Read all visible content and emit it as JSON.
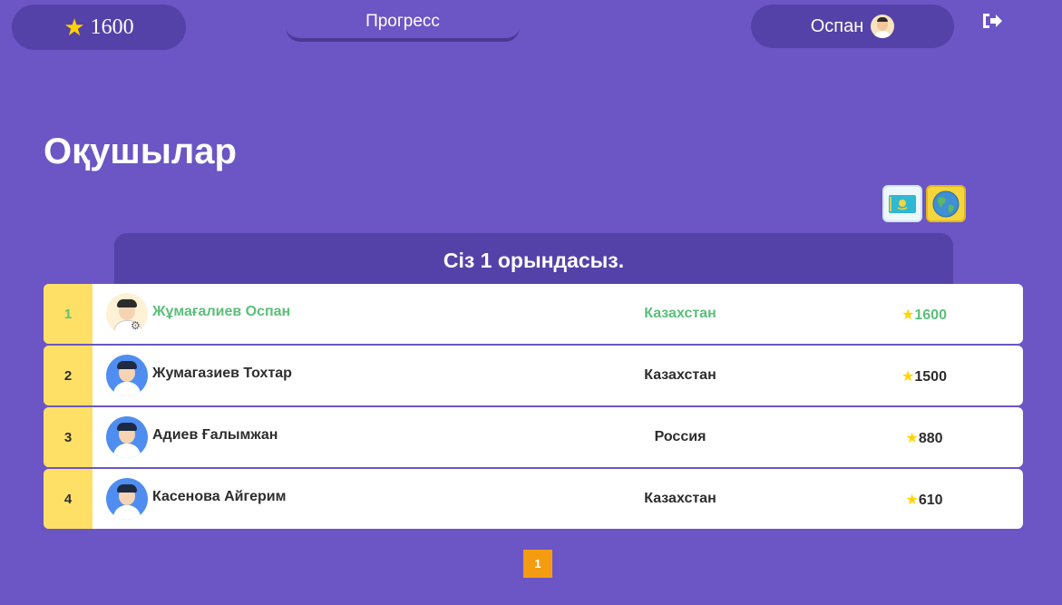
{
  "header": {
    "score": "1600",
    "progress_label": "Прогресс",
    "user_name": "Оспан"
  },
  "page": {
    "title": "Оқушылар",
    "rank_message": "Сіз 1 орындасыз."
  },
  "filters": [
    {
      "name": "kazakhstan-flag-icon"
    },
    {
      "name": "globe-icon"
    }
  ],
  "leaderboard": [
    {
      "rank": "1",
      "name": "Жұмағалиев Оспан",
      "country": "Казахстан",
      "points": "1600",
      "current_user": true
    },
    {
      "rank": "2",
      "name": "Жумагазиев Тохтар",
      "country": "Казахстан",
      "points": "1500"
    },
    {
      "rank": "3",
      "name": "Адиев Ғалымжан",
      "country": "Россия",
      "points": "880"
    },
    {
      "rank": "4",
      "name": "Касенова Айгерим",
      "country": "Казахстан",
      "points": "610"
    }
  ],
  "pagination": {
    "current_page": "1"
  },
  "colors": {
    "background": "#6c55c4",
    "panel": "#5542a8",
    "rank_cell": "#ffe066",
    "highlight": "#5bbf7a",
    "page_button": "#f39c12",
    "star": "#ffd400"
  }
}
